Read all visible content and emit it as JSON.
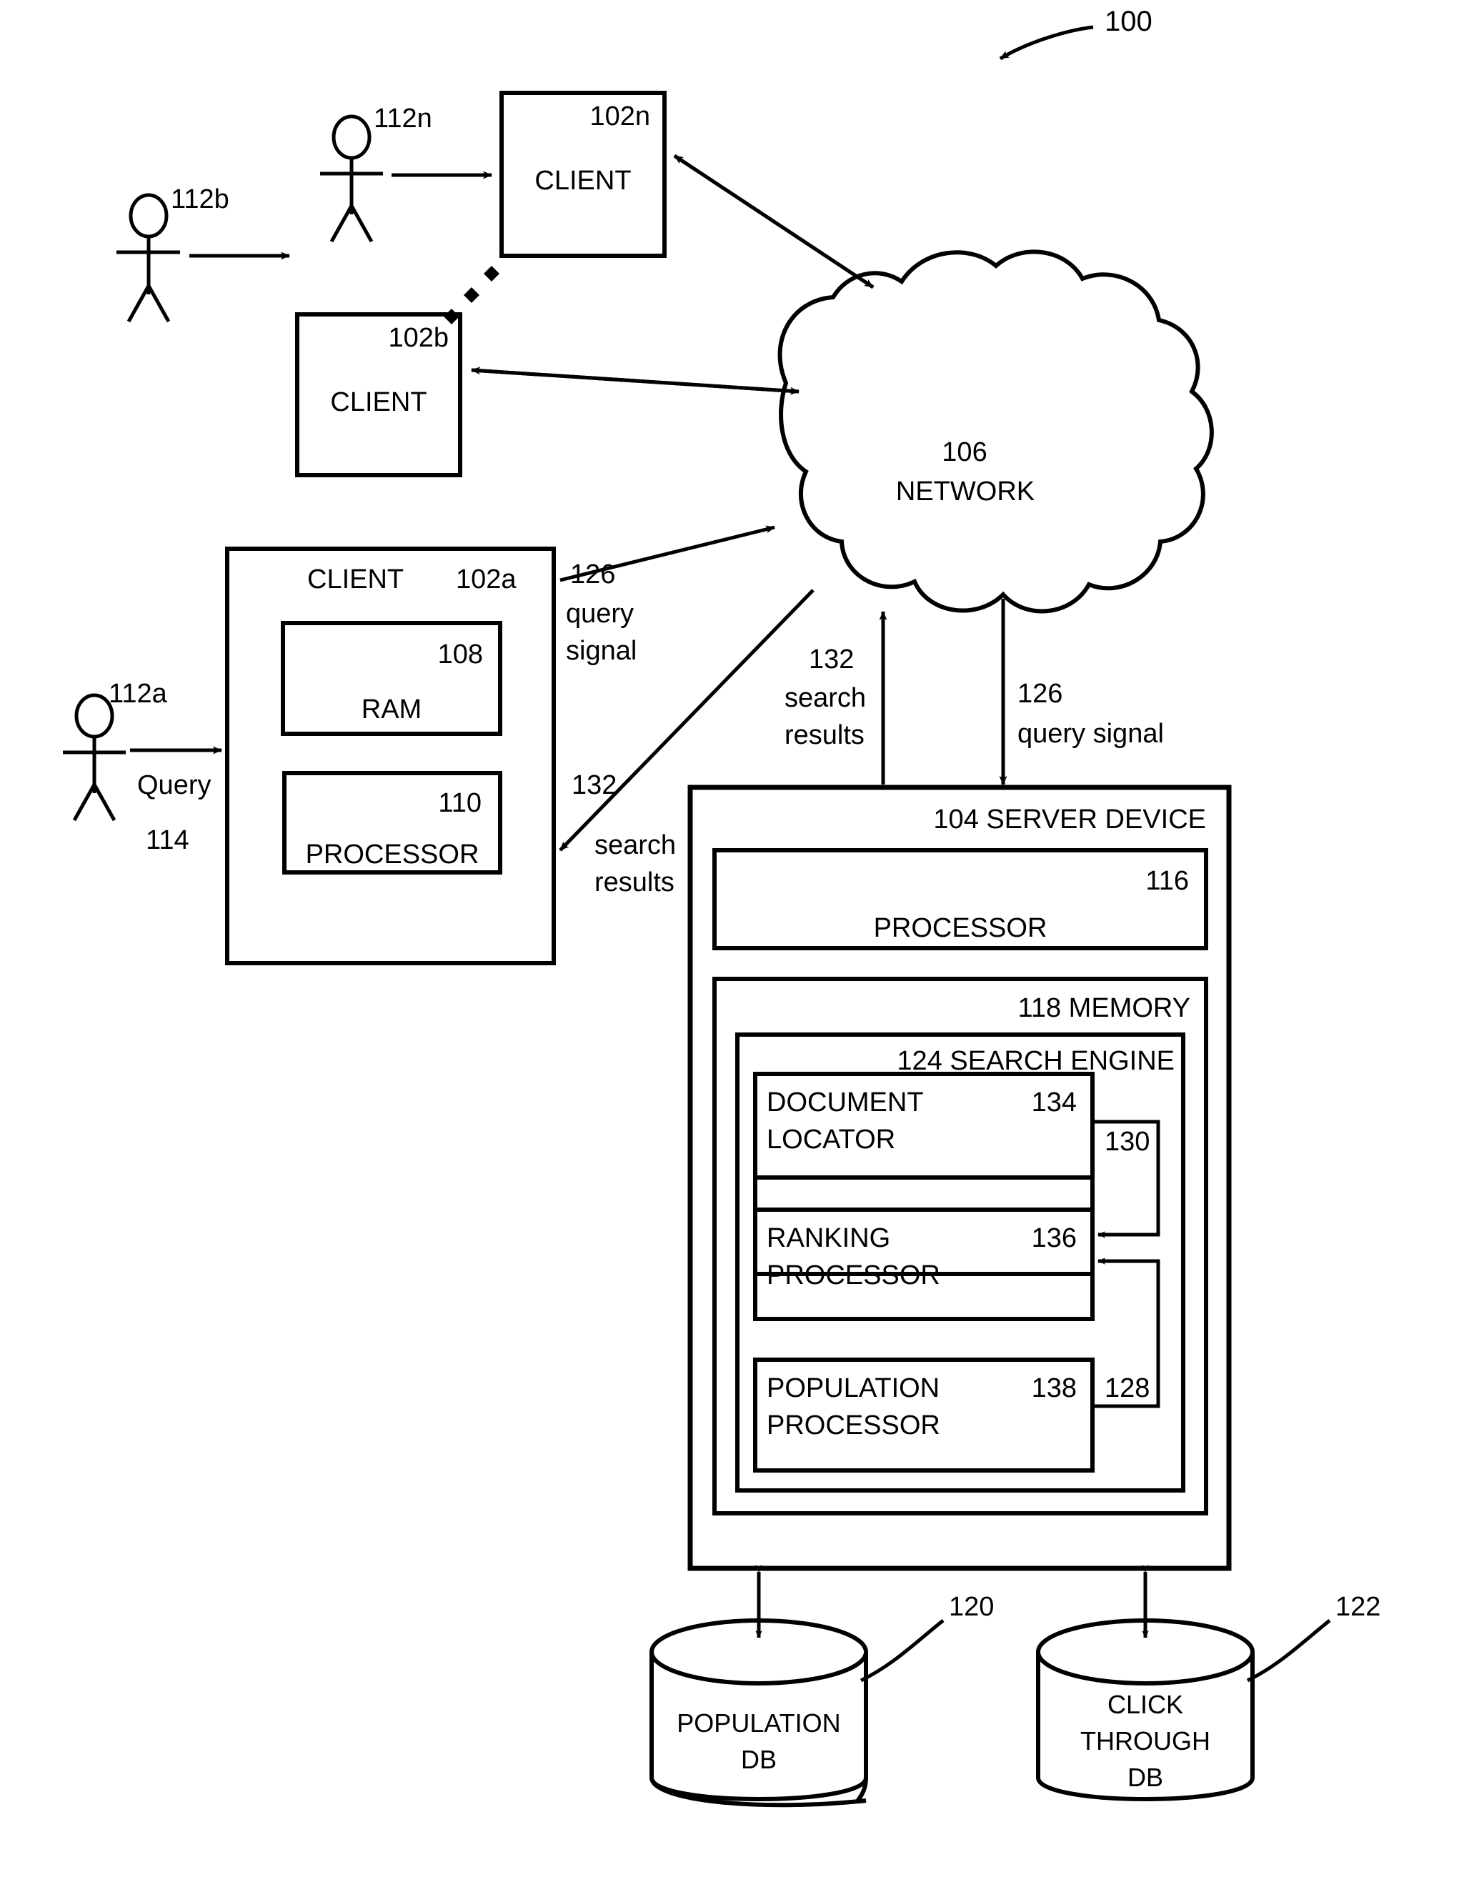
{
  "figure": {
    "number": "100",
    "title_items": {
      "client_n_label": "CLIENT",
      "client_n_ref": "102n",
      "user_n_ref": "112n",
      "client_b_label": "CLIENT",
      "client_b_ref": "102b",
      "user_b_ref": "112b",
      "client_a_label": "CLIENT",
      "client_a_ref": "102a",
      "user_a_ref": "112a",
      "query_label": "Query",
      "query_ref": "114",
      "ram_label": "RAM",
      "ram_ref": "108",
      "client_processor_label": "PROCESSOR",
      "client_processor_ref": "110"
    }
  },
  "network": {
    "ref": "106",
    "label": "NETWORK"
  },
  "signals": {
    "query_signal_left_ref": "126",
    "query_signal_left_line1": "query",
    "query_signal_left_line2": "signal",
    "search_results_left_ref": "132",
    "search_results_left_line1": "search",
    "search_results_left_line2": "results",
    "search_results_mid_ref": "132",
    "search_results_mid_line1": "search",
    "search_results_mid_line2": "results",
    "query_signal_right_ref": "126",
    "query_signal_right_label": "query signal"
  },
  "server": {
    "ref_and_label": "104 SERVER DEVICE",
    "processor": {
      "ref": "116",
      "label": "PROCESSOR"
    },
    "memory": {
      "ref_and_label": "118 MEMORY",
      "search_engine": {
        "ref_and_label": "124 SEARCH ENGINE",
        "modules": [
          {
            "label_line1": "DOCUMENT",
            "label_line2": "LOCATOR",
            "ref": "134"
          },
          {
            "label_line1": "RANKING",
            "label_line2": "PROCESSOR",
            "ref": "136"
          },
          {
            "label_line1": "POPULATION",
            "label_line2": "PROCESSOR",
            "ref": "138"
          }
        ],
        "connector_refs": {
          "locator_to_ranking": "130",
          "population_to_ranking": "128"
        }
      }
    }
  },
  "databases": [
    {
      "line1": "POPULATION",
      "line2": "DB",
      "line3": "",
      "ref": "120"
    },
    {
      "line1": "CLICK",
      "line2": "THROUGH",
      "line3": "DB",
      "ref": "122"
    }
  ],
  "colors": {
    "ink": "#000000",
    "paper": "#ffffff"
  }
}
